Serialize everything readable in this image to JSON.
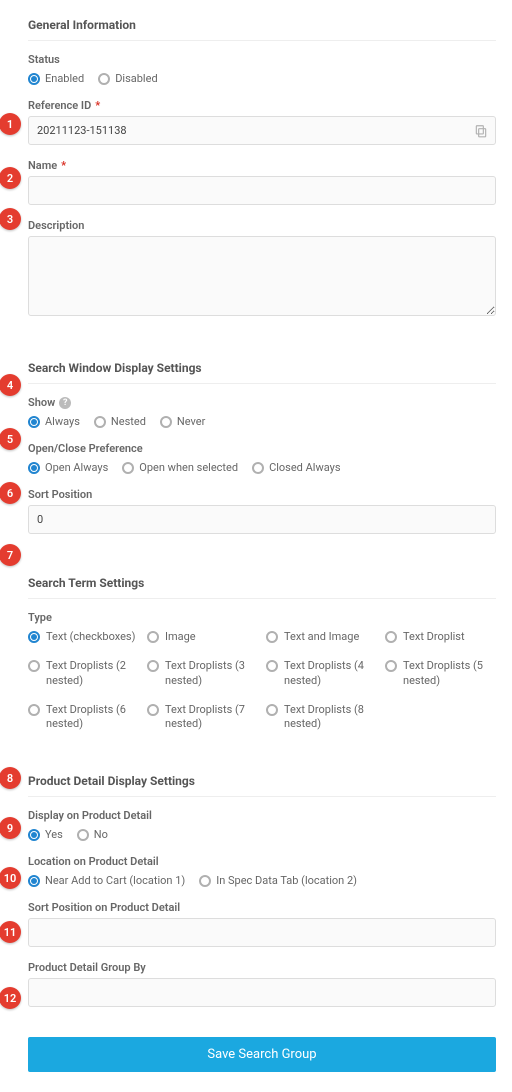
{
  "bubbles": [
    "1",
    "2",
    "3",
    "4",
    "5",
    "6",
    "7",
    "8",
    "9",
    "10",
    "11",
    "12"
  ],
  "general": {
    "title": "General Information",
    "status": {
      "label": "Status",
      "enabled": "Enabled",
      "disabled": "Disabled",
      "value": "enabled"
    },
    "reference": {
      "label": "Reference ID",
      "value": "20211123-151138"
    },
    "name": {
      "label": "Name",
      "value": ""
    },
    "description": {
      "label": "Description",
      "value": ""
    }
  },
  "swds": {
    "title": "Search Window Display Settings",
    "show": {
      "label": "Show",
      "options": [
        "Always",
        "Nested",
        "Never"
      ],
      "value": "Always"
    },
    "openclose": {
      "label": "Open/Close Preference",
      "options": [
        "Open Always",
        "Open when selected",
        "Closed Always"
      ],
      "value": "Open Always"
    },
    "sort": {
      "label": "Sort Position",
      "value": "0"
    }
  },
  "sts": {
    "title": "Search Term Settings",
    "type": {
      "label": "Type",
      "options": [
        "Text (checkboxes)",
        "Image",
        "Text and Image",
        "Text Droplist",
        "Text Droplists (2 nested)",
        "Text Droplists (3 nested)",
        "Text Droplists (4 nested)",
        "Text Droplists (5 nested)",
        "Text Droplists (6 nested)",
        "Text Droplists (7 nested)",
        "Text Droplists (8 nested)"
      ],
      "value": "Text (checkboxes)"
    }
  },
  "pdds": {
    "title": "Product Detail Display Settings",
    "display": {
      "label": "Display on Product Detail",
      "options": [
        "Yes",
        "No"
      ],
      "value": "Yes"
    },
    "location": {
      "label": "Location on Product Detail",
      "options": [
        "Near Add to Cart (location 1)",
        "In Spec Data Tab (location 2)"
      ],
      "value": "Near Add to Cart (location 1)"
    },
    "sort": {
      "label": "Sort Position on Product Detail",
      "value": ""
    },
    "groupby": {
      "label": "Product Detail Group By",
      "value": ""
    }
  },
  "save_label": "Save Search Group"
}
